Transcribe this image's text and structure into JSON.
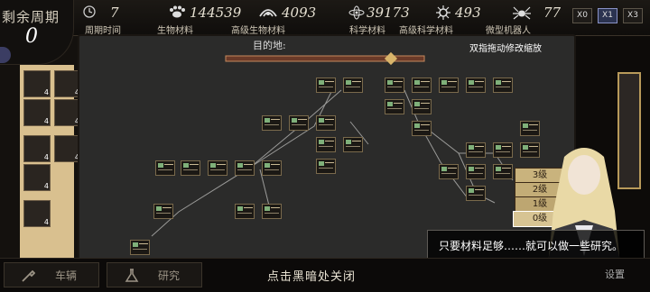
{
  "period": {
    "label": "剩余周期",
    "remaining": "0",
    "cycle_value": "7",
    "cycle_label": "周期时间"
  },
  "resources": [
    {
      "icon": "paw-icon",
      "value": "144539",
      "label": "生物材料"
    },
    {
      "icon": "claw-icon",
      "value": "4093",
      "label": "高级生物材料"
    },
    {
      "icon": "atom-icon",
      "value": "39173",
      "label": "科学材料"
    },
    {
      "icon": "cell-icon",
      "value": "493",
      "label": "高级科学材料"
    },
    {
      "icon": "spider-icon",
      "value": "77",
      "label": "微型机器人"
    }
  ],
  "speed_buttons": [
    "X0",
    "X1",
    "X3"
  ],
  "active_speed": "X1",
  "map": {
    "goal_label": "目的地:",
    "pinch_hint": "双指拖动修改缩放"
  },
  "inventory": [
    {
      "count": "4"
    },
    {
      "count": "4"
    },
    {
      "count": "4"
    },
    {
      "count": "4"
    },
    {
      "count": "4"
    },
    {
      "count": "4"
    },
    {
      "count": "4"
    },
    {
      "count": "4"
    }
  ],
  "levels": [
    "3级",
    "2级",
    "1级",
    "0级"
  ],
  "dialog": {
    "text": "只要材料足够……就可以做一些研究。"
  },
  "bottom_tabs": {
    "vehicle": "车辆",
    "research": "研究",
    "settings": "设置"
  },
  "close_hint": "点击黑暗处关闭",
  "colors": {
    "accent_gold": "#b89a5a",
    "node_border": "#7a6a4c",
    "speed_active": "#2b3350"
  }
}
